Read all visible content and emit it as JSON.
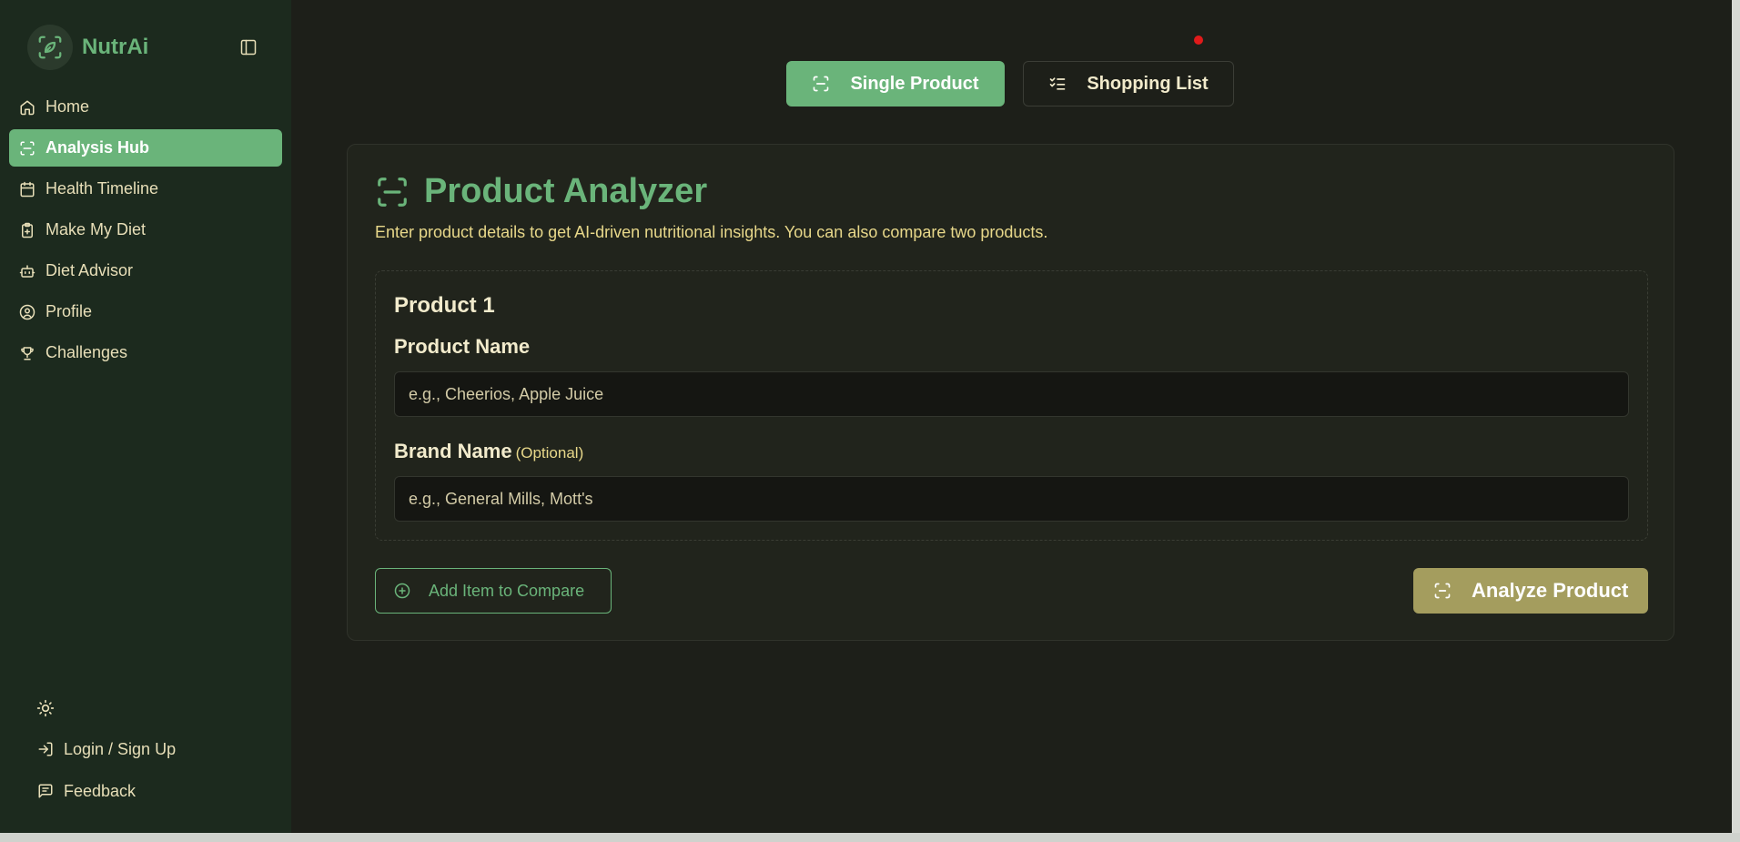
{
  "app": {
    "name": "NutrAi"
  },
  "sidebar": {
    "items": [
      {
        "label": "Home",
        "icon": "home-icon",
        "active": false
      },
      {
        "label": "Analysis Hub",
        "icon": "scan-icon",
        "active": true
      },
      {
        "label": "Health Timeline",
        "icon": "calendar-icon",
        "active": false
      },
      {
        "label": "Make My Diet",
        "icon": "clipboard-icon",
        "active": false
      },
      {
        "label": "Diet Advisor",
        "icon": "bot-icon",
        "active": false
      },
      {
        "label": "Profile",
        "icon": "user-circle-icon",
        "active": false
      },
      {
        "label": "Challenges",
        "icon": "trophy-icon",
        "active": false
      }
    ],
    "bottom": {
      "theme_icon": "sun-icon",
      "login_label": "Login / Sign Up",
      "feedback_label": "Feedback"
    }
  },
  "tabs": {
    "single_label": "Single Product",
    "list_label": "Shopping List"
  },
  "analyzer": {
    "title": "Product Analyzer",
    "subtitle": "Enter product details to get AI-driven nutritional insights. You can also compare two products.",
    "product_title": "Product 1",
    "product_name_label": "Product Name",
    "product_name_placeholder": "e.g., Cheerios, Apple Juice",
    "brand_name_label": "Brand Name",
    "brand_optional": "(Optional)",
    "brand_name_placeholder": "e.g., General Mills, Mott's",
    "compare_label": "Add Item to Compare",
    "analyze_label": "Analyze Product"
  },
  "colors": {
    "accent": "#6ab47a",
    "sidebar_bg": "#1c2a1e",
    "main_bg": "#1d1f19",
    "analyze_bg": "#a49d5e",
    "text": "#e8dfb8"
  }
}
